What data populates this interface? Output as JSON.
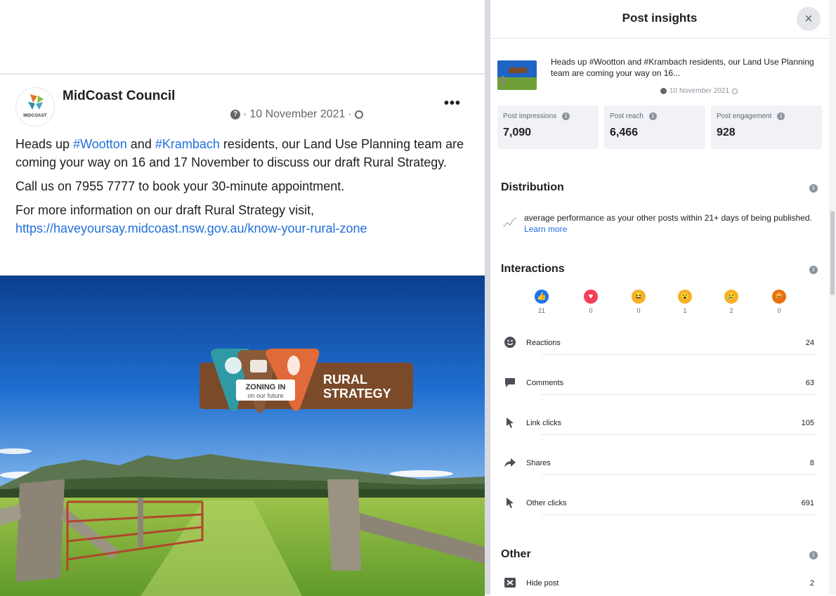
{
  "post": {
    "page_name": "MidCoast Council",
    "avatar_text": "MIDCOAST",
    "date": "10 November 2021",
    "separator": "·",
    "more_label": "•••",
    "paragraph1": {
      "pre": "Heads up ",
      "tag1": "#Wootton",
      "mid": " and ",
      "tag2": "#Krambach",
      "post": " residents, our Land Use Planning team are coming your way on 16 and 17 November to discuss our draft Rural Strategy."
    },
    "paragraph2": "Call us on 7955 7777 to book your 30-minute appointment.",
    "paragraph3": "For more information on our draft Rural Strategy visit,",
    "link": "https://haveyoursay.midcoast.nsw.gov.au/know-your-rural-zone",
    "image": {
      "badge_line1": "ZONING IN",
      "badge_line2": "on our future",
      "title_line1": "RURAL",
      "title_line2": "STRATEGY"
    }
  },
  "insights": {
    "title": "Post insights",
    "close_label": "×",
    "preview_text": "Heads up #Wootton and #Krambach residents, our Land Use Planning team are coming your way on 16...",
    "preview_date": "10 November 2021",
    "stats": [
      {
        "label": "Post impressions",
        "value": "7,090"
      },
      {
        "label": "Post reach",
        "value": "6,466"
      },
      {
        "label": "Post engagement",
        "value": "928"
      }
    ],
    "distribution": {
      "title": "Distribution",
      "text": "average performance as your other posts within 21+ days of being published.",
      "learn_more": "Learn more"
    },
    "interactions": {
      "title": "Interactions",
      "reactions": [
        {
          "name": "like",
          "count": "21",
          "color": "#1877f2",
          "glyph": "👍"
        },
        {
          "name": "love",
          "count": "0",
          "color": "#f33e58",
          "glyph": "♥"
        },
        {
          "name": "haha",
          "count": "0",
          "color": "#f7b125",
          "glyph": "😆"
        },
        {
          "name": "wow",
          "count": "1",
          "color": "#f7b125",
          "glyph": "😮"
        },
        {
          "name": "sad",
          "count": "2",
          "color": "#f7b125",
          "glyph": "😢"
        },
        {
          "name": "angry",
          "count": "0",
          "color": "#e9710f",
          "glyph": "😡"
        }
      ],
      "metrics": [
        {
          "label": "Reactions",
          "value": "24",
          "icon": "smiley-icon"
        },
        {
          "label": "Comments",
          "value": "63",
          "icon": "comment-icon"
        },
        {
          "label": "Link clicks",
          "value": "105",
          "icon": "cursor-icon"
        },
        {
          "label": "Shares",
          "value": "8",
          "icon": "share-icon"
        },
        {
          "label": "Other clicks",
          "value": "691",
          "icon": "cursor-icon"
        }
      ]
    },
    "other": {
      "title": "Other",
      "metrics": [
        {
          "label": "Hide post",
          "value": "2",
          "icon": "hide-icon"
        }
      ]
    }
  }
}
